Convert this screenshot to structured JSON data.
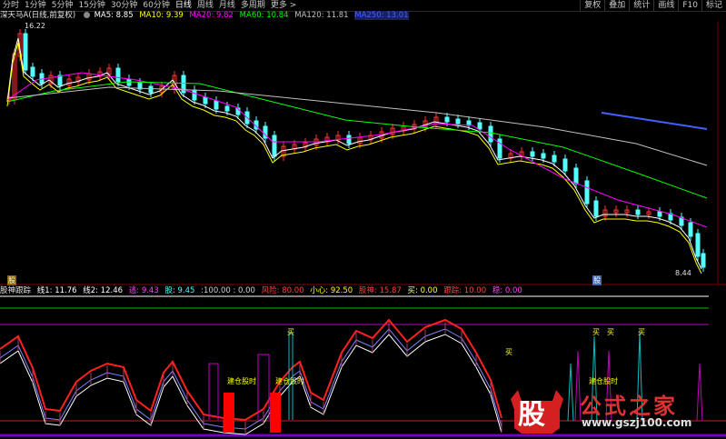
{
  "toolbar": {
    "tabs": [
      "分时",
      "1分钟",
      "5分钟",
      "15分钟",
      "30分钟",
      "60分钟",
      "日线",
      "周线",
      "月线",
      "多周期",
      "更多 >"
    ],
    "active_tab": "日线",
    "right_buttons": [
      "复权",
      "叠加",
      "统计",
      "画线",
      "F10",
      "标记"
    ]
  },
  "main_legend": {
    "stock": "深天马A(日线,前复权)",
    "ma5": "MA5: 8.85",
    "ma10": "MA10: 9.39",
    "ma20": "MA20: 9.82",
    "ma60": "MA60: 10.84",
    "ma120": "MA120: 11.81",
    "ma250": "MA250: 13.01"
  },
  "price_marks": {
    "high": "16.22",
    "low": "8.44"
  },
  "ind_legend": {
    "name": "股神跟踪",
    "x1": "线1: 11.76",
    "x2": "线2: 12.46",
    "s1": "逃: 9.43",
    "s2": "股: 9.45",
    "s3": ":100.00 : 0.00",
    "s4": "风险: 80.00",
    "s5": "小心: 92.50",
    "s6": "股神: 15.87",
    "s7": "买: 0.00",
    "s8": "跟踪: 10.00",
    "s9": "稳: 0.00"
  },
  "signals": {
    "buy": "买",
    "label1": "建仓股时",
    "label2": "建仓股时",
    "label3": "建仓股时",
    "flag": "股"
  },
  "watermark": {
    "logo": "股",
    "name": "公式之家",
    "url": "www.gszj100.com"
  },
  "colors": {
    "up": "#ff3232",
    "down": "#54ffff",
    "ma5": "#ffffff",
    "ma10": "#ffff00",
    "ma20": "#ff00ff",
    "ma60": "#00ff00",
    "ma120": "#c0c0c0",
    "ma250": "#4060ff"
  }
}
